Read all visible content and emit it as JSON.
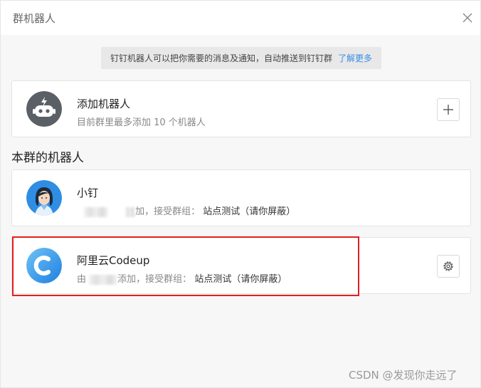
{
  "dialog": {
    "title": "群机器人",
    "close_icon": "close-icon"
  },
  "notice": {
    "text": "钉钉机器人可以把你需要的消息及通知，自动推送到钉钉群",
    "link": "了解更多",
    "link_color": "#3a8ee6"
  },
  "add_robot": {
    "title": "添加机器人",
    "subtitle": "目前群里最多添加 10 个机器人",
    "icon": "robot-icon",
    "button_icon": "plus-icon"
  },
  "section": {
    "title": "本群的机器人"
  },
  "robots": [
    {
      "name": "小钉",
      "prefix": "",
      "suffix": "加，接受群组：",
      "group": "站点测试（请你屏蔽）",
      "avatar": "girl-avatar"
    },
    {
      "name": "阿里云Codeup",
      "prefix": "由",
      "suffix": "添加，接受群组：",
      "group": "站点测试（请你屏蔽）",
      "avatar": "codeup-logo",
      "button_icon": "gear-icon",
      "brand_color": "#2b8ce6"
    }
  ],
  "highlight_color": "#e02020",
  "watermark": "CSDN @发现你走远了"
}
